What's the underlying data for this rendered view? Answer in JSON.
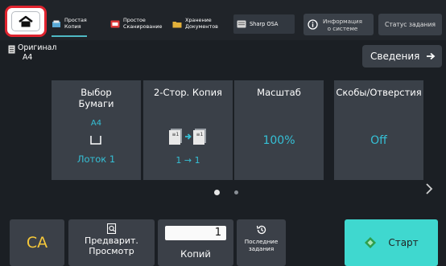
{
  "top_bar": {
    "tabs": [
      {
        "line1": "Простая",
        "line2": "Копия"
      },
      {
        "line1": "Простое",
        "line2": "Сканирование"
      },
      {
        "line1": "Хранение",
        "line2": "Документов"
      }
    ],
    "sharp_osa": "Sharp OSA",
    "info": {
      "line1": "Информация",
      "line2": "о системе"
    },
    "status": "Статус задания",
    "accent_color": "#4fb9c4",
    "home_highlight_color": "#e0242f"
  },
  "original": {
    "label": "Оригинал",
    "value": "A4"
  },
  "details_button": "Сведения",
  "cards": [
    {
      "title1": "Выбор",
      "title2": "Бумаги",
      "sub": "A4",
      "value": "Лоток 1"
    },
    {
      "title": "2-Стор. Копия",
      "value": "1 → 1"
    },
    {
      "title": "Масштаб",
      "value": "100%"
    },
    {
      "title": "Скобы/Отверстия",
      "value": "Off"
    }
  ],
  "pager": {
    "pages": 2,
    "current": 1
  },
  "bottom": {
    "ca": "CA",
    "preview": {
      "line1": "Предварит.",
      "line2": "Просмотр"
    },
    "copies_value": "1",
    "copies_label": "Копий",
    "recent": {
      "line1": "Последние",
      "line2": "задания"
    },
    "start": "Старт",
    "start_color": "#3fd8cf"
  }
}
